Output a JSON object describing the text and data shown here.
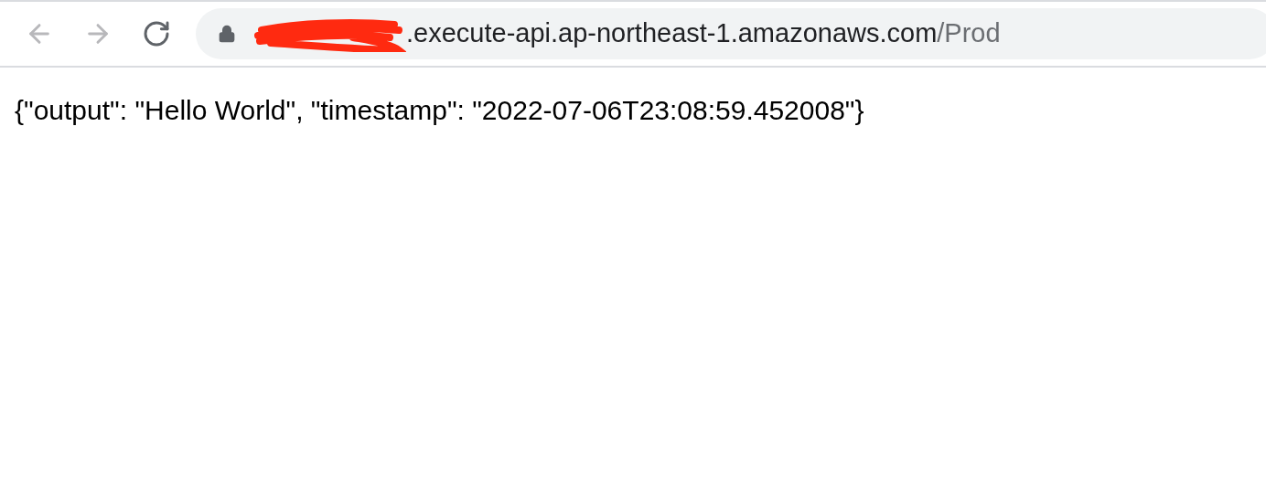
{
  "toolbar": {
    "nav_buttons": [
      {
        "kind": "back",
        "disabled": true
      },
      {
        "kind": "forward",
        "disabled": true
      },
      {
        "kind": "reload",
        "disabled": false
      }
    ]
  },
  "address_bar": {
    "secure": true,
    "url_host": ".execute-api.ap-northeast-1.amazonaws.com",
    "url_path": "/Prod"
  },
  "page": {
    "body_text": "{\"output\": \"Hello World\", \"timestamp\": \"2022-07-06T23:08:59.452008\"}"
  }
}
